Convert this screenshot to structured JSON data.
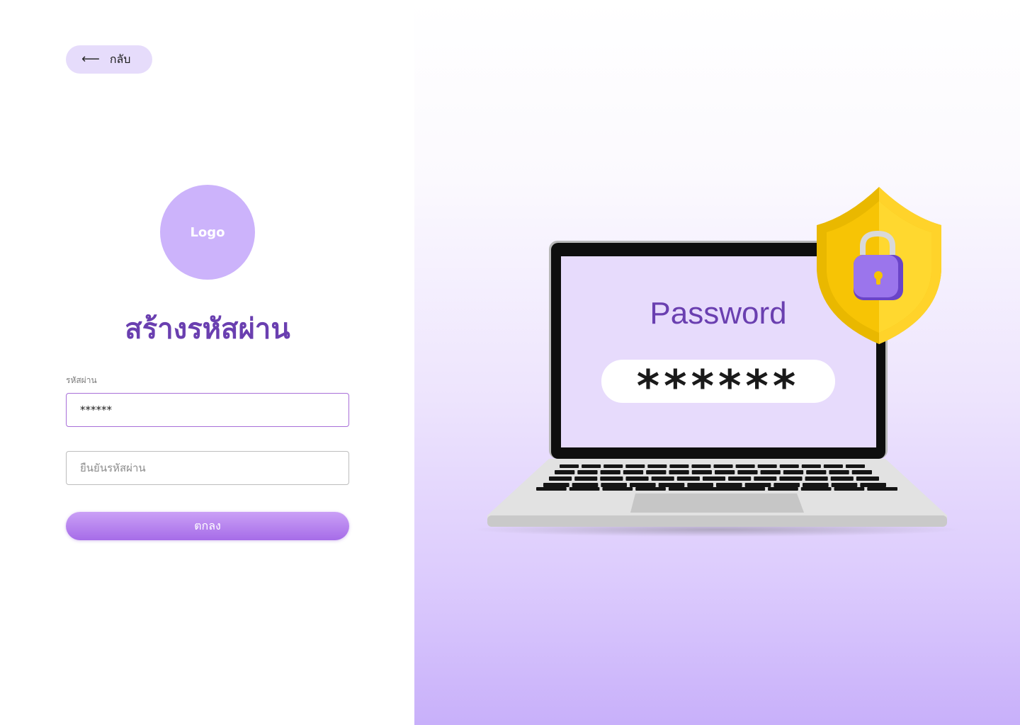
{
  "back_button": {
    "label": "กลับ",
    "icon": "arrow-left-icon"
  },
  "logo": {
    "text": "Logo",
    "color": "#ccb3fb"
  },
  "page_title": "สร้างรหัสผ่าน",
  "form": {
    "password": {
      "label": "รหัสผ่าน",
      "value": "******",
      "placeholder": ""
    },
    "confirm_password": {
      "value": "",
      "placeholder": "ยืนยันรหัสผ่าน"
    },
    "submit_label": "ตกลง"
  },
  "illustration": {
    "screen_title": "Password",
    "masked_text": "******",
    "icons": [
      "laptop-icon",
      "shield-icon",
      "padlock-icon"
    ],
    "colors": {
      "accent": "#6a3fb0",
      "shield": "#f6c300",
      "lock": "#8b63e0"
    }
  }
}
